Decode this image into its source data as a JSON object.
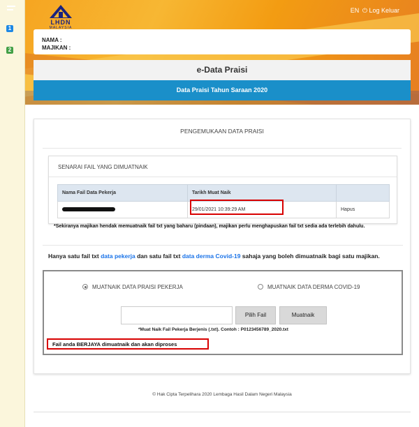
{
  "header": {
    "logo_text": "LHDN",
    "logo_subtext": "MALAYSIA",
    "lang": "EN",
    "logout_label": "Log Keluar"
  },
  "sidebar": {
    "items": [
      {
        "label": "1",
        "color": "#1e88e5"
      },
      {
        "label": "2",
        "color": "#43a047"
      }
    ]
  },
  "profile": {
    "nama_label": "NAMA :",
    "majikan_label": "MAJIKAN :"
  },
  "title": {
    "main": "e-Data Praisi",
    "sub": "Data Praisi Tahun Saraan 2020"
  },
  "main": {
    "heading": "PENGEMUKAAN DATA PRAISI",
    "list": {
      "heading": "SENARAI FAIL YANG DIMUATNAIK",
      "columns": [
        "Nama Fail Data Pekerja",
        "Tarikh Muat Naik",
        ""
      ],
      "rows": [
        {
          "tarikh": "29/01/2021 10:39:29 AM",
          "action": "Hapus"
        }
      ]
    },
    "note": "*Sekiranya majikan hendak memuatnaik fail txt yang baharu (pindaan), majikan perlu menghapuskan fail txt sedia ada terlebih dahulu.",
    "info": {
      "part1": "Hanya satu fail txt ",
      "link1": "data pekerja",
      "part2": " dan satu fail txt ",
      "link2": "data derma Covid-19",
      "part3": " sahaja yang boleh dimuatnaik bagi satu majikan."
    },
    "upload": {
      "option1": "MUATNAIK DATA PRAISI PEKERJA",
      "option2": "MUATNAIK DATA DERMA COVID-19",
      "pilih_label": "Pilih Fail",
      "muatnaik_label": "Muatnaik",
      "format_note": "*Muat Naik Fail Pekerja Berjenis (.txt). Contoh : P0123456789_2020.txt",
      "success": "Fail anda BERJAYA dimuatnaik dan akan diproses"
    }
  },
  "footer": {
    "copyright": "© Hak Cipta Terpelihara 2020 Lembaga Hasil Dalam Negeri Malaysia"
  },
  "colors": {
    "accent_blue": "#1a8fc9",
    "link_blue": "#1a73e8",
    "highlight_red": "#d80000"
  }
}
